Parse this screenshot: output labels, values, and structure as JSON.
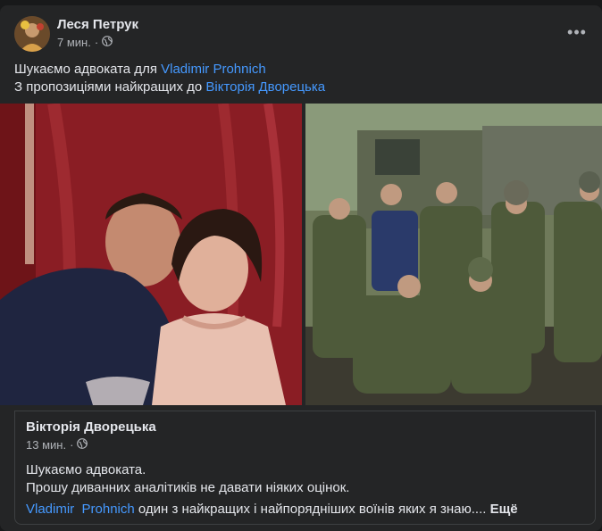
{
  "post": {
    "author": "Леся Петрук",
    "time": "7 мин.",
    "privacy_icon": "globe-icon",
    "more_icon": "more-dots-icon",
    "more_label": "•••",
    "line1_text": "Шукаємо адвоката для ",
    "line1_link": "Vladimir Prohnich",
    "line2_text": "З пропозиціями найкращих до ",
    "line2_link": "Вікторія Дворецька"
  },
  "shared": {
    "author": "Вікторія Дворецька",
    "time": "13 мин.",
    "line1": "Шукаємо адвоката.",
    "line2": "Прошу диванних аналітиків не давати ніяких оцінок.",
    "mention1": "Vladimir",
    "mention2": "Prohnich",
    "continuation": " один з найкращих і найпорядніших воїнів яких я знаю....",
    "see_more": "Ещё"
  },
  "colors": {
    "background": "#18191a",
    "card": "#242526",
    "link": "#4599ff",
    "secondary_text": "#b0b3b8"
  }
}
